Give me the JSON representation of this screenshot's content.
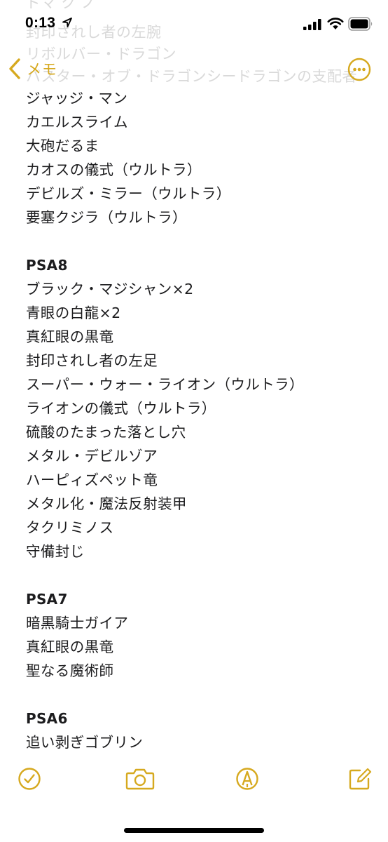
{
  "status_bar": {
    "time": "0:13"
  },
  "ghost_lines": [
    "ドマ ク ノ",
    "封印されし者の左腕",
    "リボルバー・ドラゴン",
    "バスター・オブ・ドラゴンシードラゴンの支配者"
  ],
  "nav": {
    "back_label": "メモ"
  },
  "note": {
    "lines": [
      {
        "text": "ジャッジ・マン",
        "type": "item"
      },
      {
        "text": "カエルスライム",
        "type": "item"
      },
      {
        "text": "大砲だるま",
        "type": "item"
      },
      {
        "text": "カオスの儀式（ウルトラ）",
        "type": "item"
      },
      {
        "text": "デビルズ・ミラー（ウルトラ）",
        "type": "item"
      },
      {
        "text": "要塞クジラ（ウルトラ）",
        "type": "item"
      },
      {
        "text": "",
        "type": "blank"
      },
      {
        "text": "PSA8",
        "type": "heading"
      },
      {
        "text": "ブラック・マジシャン×2",
        "type": "item"
      },
      {
        "text": "青眼の白龍×2",
        "type": "item"
      },
      {
        "text": "真紅眼の黒竜",
        "type": "item"
      },
      {
        "text": "封印されし者の左足",
        "type": "item"
      },
      {
        "text": "スーパー・ウォー・ライオン（ウルトラ）",
        "type": "item"
      },
      {
        "text": "ライオンの儀式（ウルトラ）",
        "type": "item"
      },
      {
        "text": "硫酸のたまった落とし穴",
        "type": "item"
      },
      {
        "text": "メタル・デビルゾア",
        "type": "item"
      },
      {
        "text": "ハーピィズペット竜",
        "type": "item"
      },
      {
        "text": "メタル化・魔法反射装甲",
        "type": "item"
      },
      {
        "text": "タクリミノス",
        "type": "item"
      },
      {
        "text": "守備封じ",
        "type": "item"
      },
      {
        "text": "",
        "type": "blank"
      },
      {
        "text": "PSA7",
        "type": "heading"
      },
      {
        "text": "暗黒騎士ガイア",
        "type": "item"
      },
      {
        "text": "真紅眼の黒竜",
        "type": "item"
      },
      {
        "text": "聖なる魔術師",
        "type": "item"
      },
      {
        "text": "",
        "type": "blank"
      },
      {
        "text": "PSA6",
        "type": "heading"
      },
      {
        "text": "追い剥ぎゴブリン",
        "type": "item"
      }
    ]
  },
  "toolbar": {
    "icons": [
      "checklist-icon",
      "camera-icon",
      "markup-pen-icon",
      "compose-icon"
    ]
  },
  "colors": {
    "accent": "#d6a91f",
    "text": "#1c1c1e",
    "ghost_text": "#d9d9d9"
  }
}
